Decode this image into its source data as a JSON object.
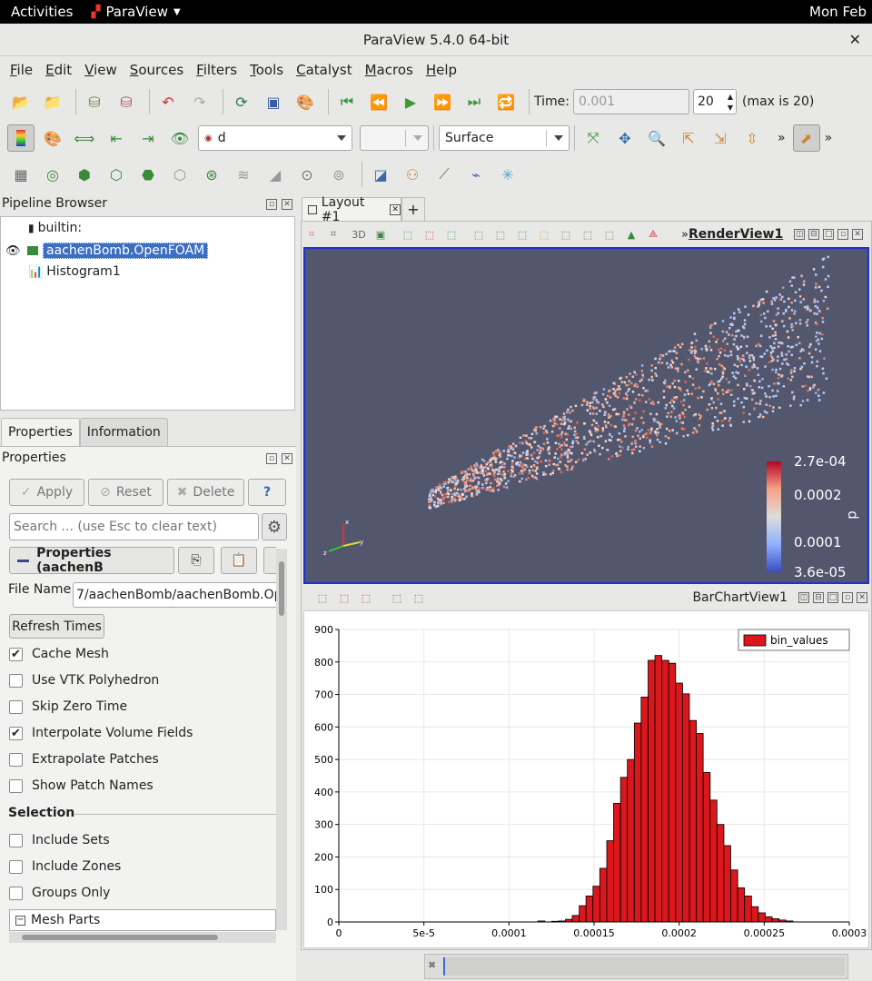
{
  "system_bar": {
    "activities": "Activities",
    "app_name": "ParaView",
    "clock": "Mon Feb"
  },
  "window": {
    "title": "ParaView 5.4.0 64-bit",
    "close": "✕"
  },
  "menu": [
    "File",
    "Edit",
    "View",
    "Sources",
    "Filters",
    "Tools",
    "Catalyst",
    "Macros",
    "Help"
  ],
  "toolbar": {
    "time_label": "Time:",
    "time_value": "0.001",
    "timestep": "20",
    "max_label": "(max is 20)",
    "array_combo": "d",
    "representation_combo": "Surface",
    "more": "»"
  },
  "pipeline_browser": {
    "title": "Pipeline Browser",
    "items": [
      {
        "label": "builtin:"
      },
      {
        "label": "aachenBomb.OpenFOAM"
      },
      {
        "label": "Histogram1"
      }
    ]
  },
  "prop_tabs": [
    "Properties",
    "Information"
  ],
  "properties": {
    "title": "Properties",
    "apply": "Apply",
    "reset": "Reset",
    "delete": "Delete",
    "help": "?",
    "search_placeholder": "Search ... (use Esc to clear text)",
    "section_label": "Properties (aachenB",
    "file_name_label": "File Name",
    "file_name_value": "7/aachenBomb/aachenBomb.OpenFOAM",
    "refresh_times": "Refresh Times",
    "checks": [
      {
        "label": "Cache Mesh",
        "checked": true
      },
      {
        "label": "Use VTK Polyhedron",
        "checked": false
      },
      {
        "label": "Skip Zero Time",
        "checked": false
      },
      {
        "label": "Interpolate Volume Fields",
        "checked": true
      },
      {
        "label": "Extrapolate Patches",
        "checked": false
      },
      {
        "label": "Show Patch Names",
        "checked": false
      }
    ],
    "selection_header": "Selection",
    "selection_checks": [
      {
        "label": "Include Sets",
        "checked": false
      },
      {
        "label": "Include Zones",
        "checked": false
      },
      {
        "label": "Groups Only",
        "checked": false
      }
    ],
    "mesh_parts": "Mesh Parts"
  },
  "layout": {
    "tab_label": "Layout #1",
    "add_tab": "+"
  },
  "render_view": {
    "label": "RenderView1",
    "toolbar_3d": "3D",
    "more": "»",
    "colorbar": {
      "title": "d",
      "labels": [
        "2.7e-04",
        "0.0002",
        "0.0001",
        "3.6e-05"
      ],
      "colors": [
        "#b40426",
        "#f6a283",
        "#dddcdc",
        "#8db0fe",
        "#3b4cc0"
      ]
    }
  },
  "bar_chart_view": {
    "label": "BarChartView1"
  },
  "chart_data": {
    "type": "bar",
    "title": "",
    "xlabel": "",
    "ylabel": "",
    "xlim": [
      0,
      0.0003
    ],
    "ylim": [
      0,
      900
    ],
    "x_ticks": [
      "0",
      "5e-5",
      "0.0001",
      "0.00015",
      "0.0002",
      "0.00025",
      "0.0003"
    ],
    "x_tick_values": [
      0,
      5e-05,
      0.0001,
      0.00015,
      0.0002,
      0.00025,
      0.0003
    ],
    "y_ticks": [
      "0",
      "100",
      "200",
      "300",
      "400",
      "500",
      "600",
      "700",
      "800",
      "900"
    ],
    "y_tick_values": [
      0,
      100,
      200,
      300,
      400,
      500,
      600,
      700,
      800,
      900
    ],
    "bar_width": 4.05e-06,
    "bar_color": "#d9171c",
    "legend_position": "top-right",
    "series": [
      {
        "name": "bin_values",
        "x": [
          3.79e-05,
          4.2e-05,
          4.6e-05,
          5.01e-05,
          5.42e-05,
          5.82e-05,
          6.23e-05,
          6.63e-05,
          7.04e-05,
          7.44e-05,
          7.85e-05,
          8.25e-05,
          8.66e-05,
          9.06e-05,
          9.47e-05,
          9.87e-05,
          0.0001028,
          0.0001068,
          0.0001109,
          0.0001149,
          0.000119,
          0.000123,
          0.0001271,
          0.0001311,
          0.0001352,
          0.0001392,
          0.0001433,
          0.0001473,
          0.0001514,
          0.0001554,
          0.0001595,
          0.0001635,
          0.0001676,
          0.0001716,
          0.0001757,
          0.0001797,
          0.0001838,
          0.0001878,
          0.0001919,
          0.0001959,
          0.0002,
          0.000204,
          0.0002081,
          0.0002121,
          0.0002162,
          0.0002202,
          0.0002243,
          0.0002283,
          0.0002324,
          0.0002364,
          0.0002405,
          0.0002445,
          0.0002486,
          0.0002526,
          0.0002567,
          0.0002607,
          0.0002648,
          0.0002688
        ],
        "values": [
          0,
          0,
          0,
          0,
          0,
          0,
          0,
          0,
          0,
          0,
          0,
          0,
          0,
          0,
          0,
          0,
          0,
          0,
          0,
          0,
          3,
          0,
          2,
          3,
          8,
          20,
          50,
          80,
          110,
          165,
          250,
          365,
          445,
          500,
          612,
          692,
          805,
          820,
          805,
          796,
          735,
          702,
          620,
          580,
          460,
          375,
          300,
          235,
          160,
          105,
          80,
          47,
          28,
          16,
          10,
          6,
          3,
          0
        ]
      }
    ]
  }
}
